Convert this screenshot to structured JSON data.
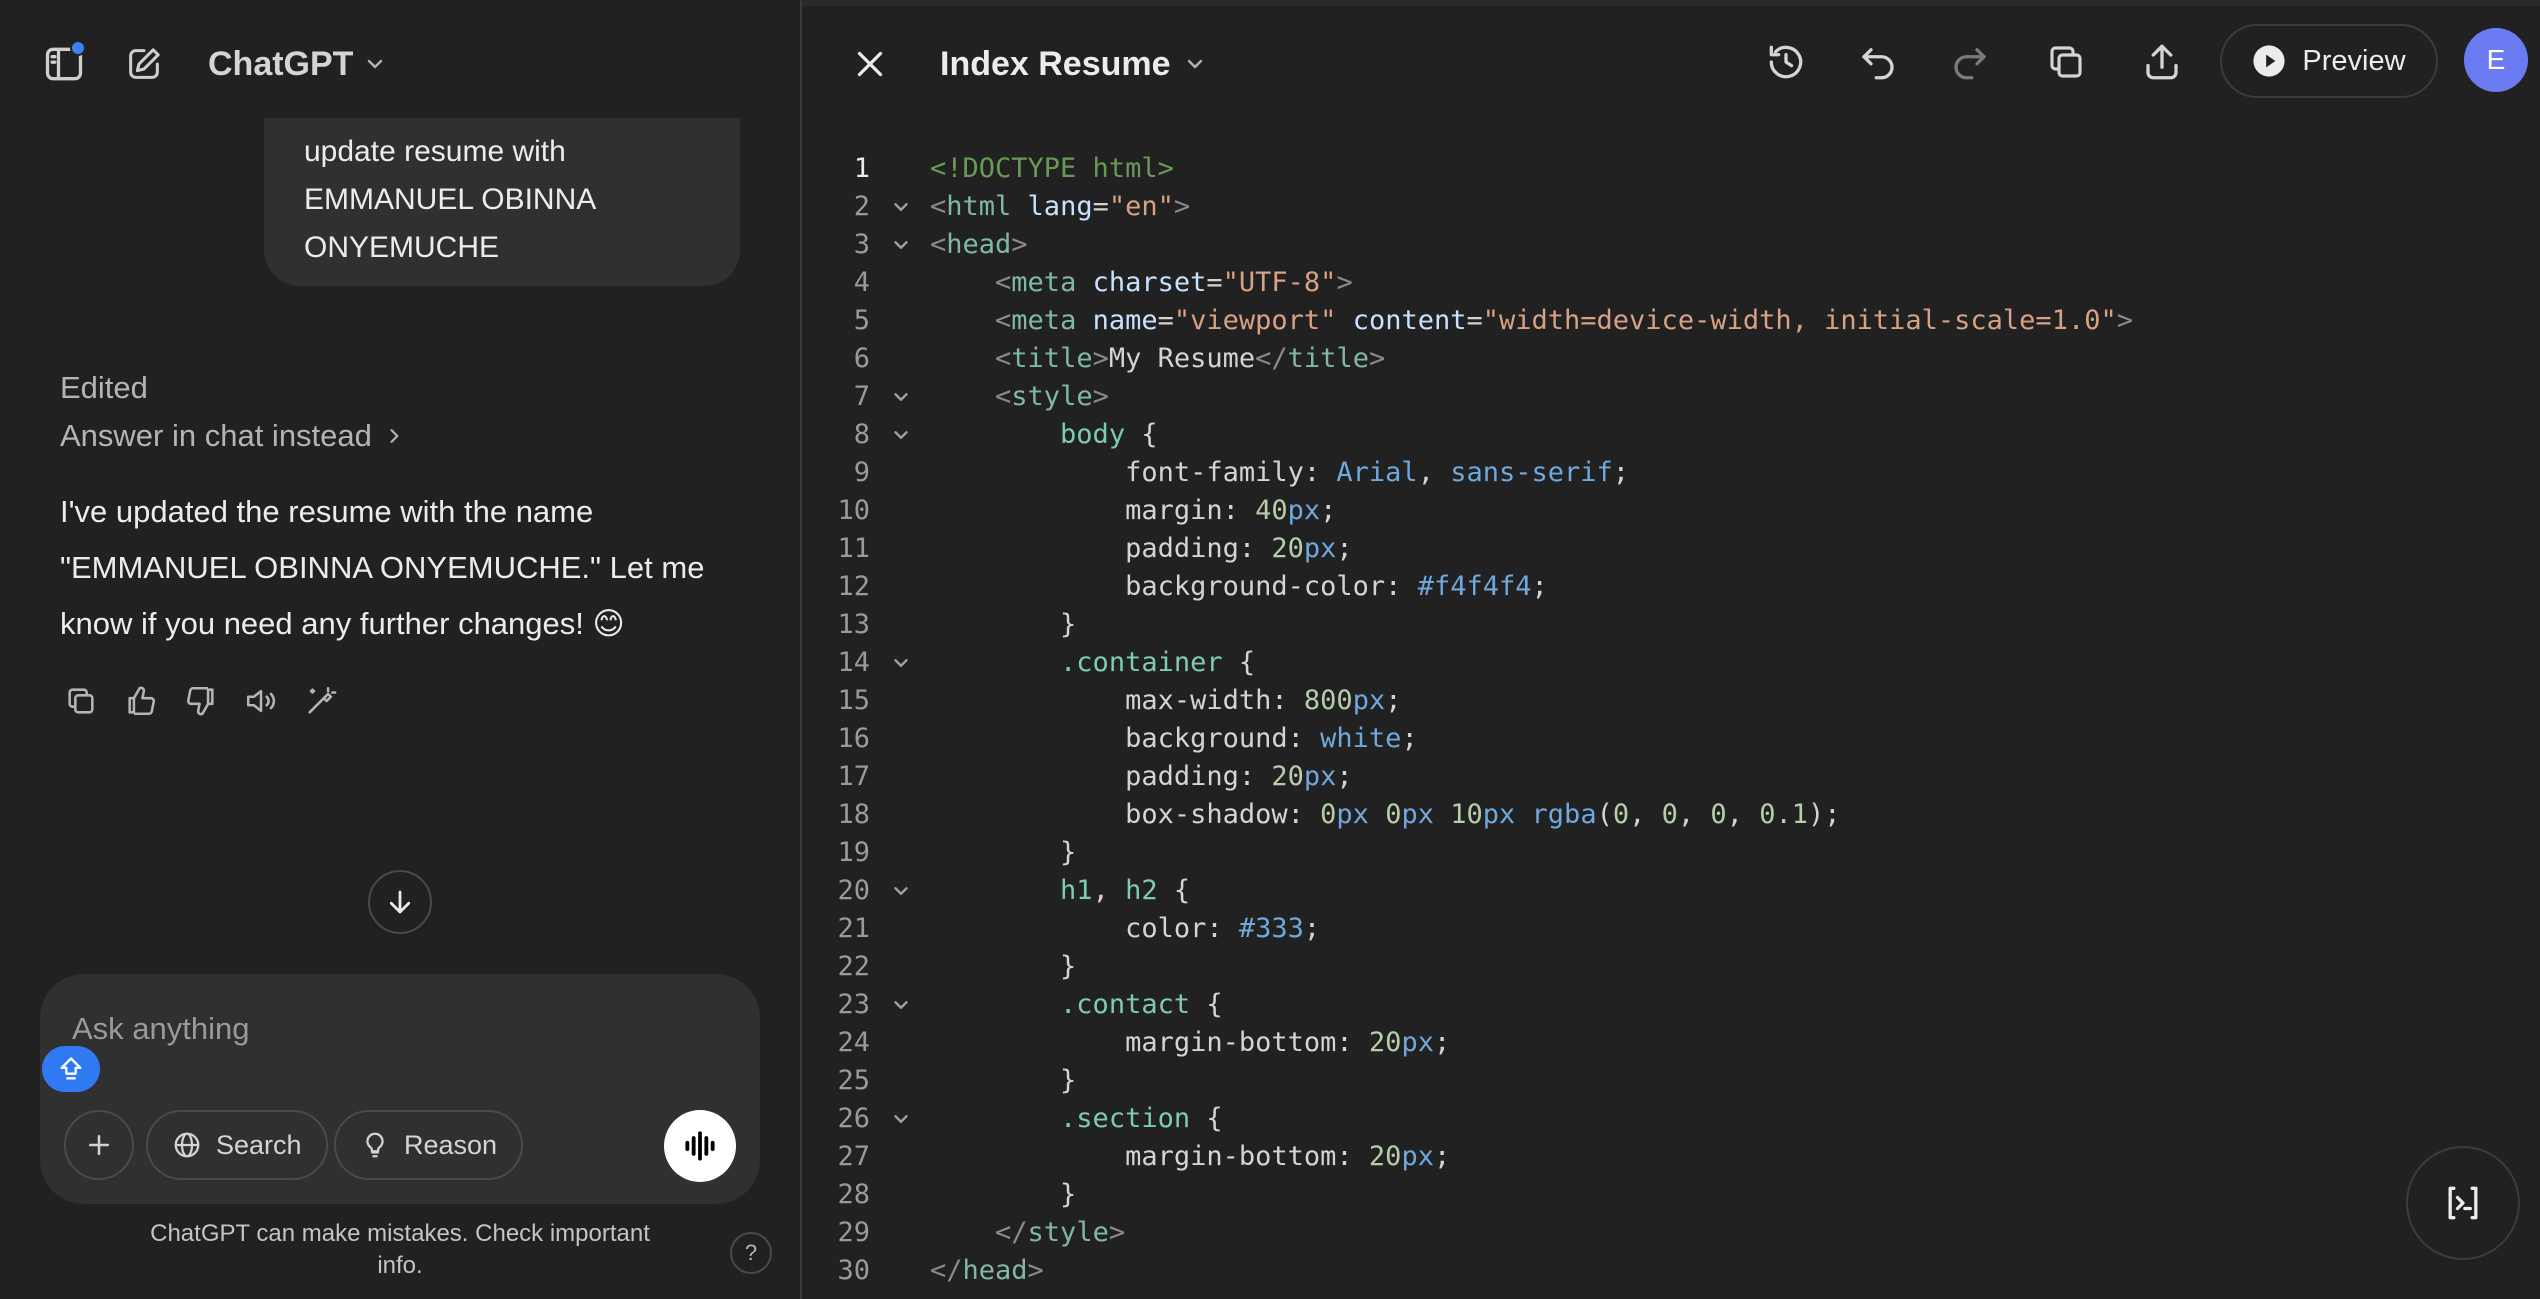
{
  "chat": {
    "model_name": "ChatGPT",
    "user_message_lines": [
      "update resume with",
      "EMMANUEL OBINNA",
      "ONYEMUCHE"
    ],
    "edited_label": "Edited",
    "answer_in_chat_label": "Answer in chat instead",
    "assistant_message_lines": [
      "I've updated the resume with the name",
      "\"EMMANUEL OBINNA ONYEMUCHE.\" Let me",
      "know if you need any further changes! 😊"
    ],
    "composer": {
      "placeholder": "Ask anything",
      "search_label": "Search",
      "reason_label": "Reason"
    },
    "disclaimer_lines": [
      "ChatGPT can make mistakes. Check important",
      "info."
    ],
    "help_label": "?"
  },
  "canvas": {
    "title": "Index Resume",
    "preview_label": "Preview",
    "avatar_initial": "E",
    "code_lines": [
      {
        "n": "1",
        "fold": false,
        "segs": [
          [
            "doc",
            "<!DOCTYPE html>"
          ]
        ]
      },
      {
        "n": "2",
        "fold": true,
        "segs": [
          [
            "br",
            "<"
          ],
          [
            "tag",
            "html"
          ],
          [
            "attr",
            " lang"
          ],
          [
            "pun",
            "="
          ],
          [
            "str",
            "\"en\""
          ],
          [
            "br",
            ">"
          ]
        ]
      },
      {
        "n": "3",
        "fold": true,
        "segs": [
          [
            "br",
            "<"
          ],
          [
            "tag",
            "head"
          ],
          [
            "br",
            ">"
          ]
        ]
      },
      {
        "n": "4",
        "fold": false,
        "segs": [
          [
            "txt",
            "    "
          ],
          [
            "br",
            "<"
          ],
          [
            "tag",
            "meta"
          ],
          [
            "attr",
            " charset"
          ],
          [
            "pun",
            "="
          ],
          [
            "str",
            "\"UTF-8\""
          ],
          [
            "br",
            ">"
          ]
        ]
      },
      {
        "n": "5",
        "fold": false,
        "segs": [
          [
            "txt",
            "    "
          ],
          [
            "br",
            "<"
          ],
          [
            "tag",
            "meta"
          ],
          [
            "attr",
            " name"
          ],
          [
            "pun",
            "="
          ],
          [
            "str",
            "\"viewport\""
          ],
          [
            "attr",
            " content"
          ],
          [
            "pun",
            "="
          ],
          [
            "str",
            "\"width=device-width, initial-scale=1.0\""
          ],
          [
            "br",
            ">"
          ]
        ]
      },
      {
        "n": "6",
        "fold": false,
        "segs": [
          [
            "txt",
            "    "
          ],
          [
            "br",
            "<"
          ],
          [
            "tag",
            "title"
          ],
          [
            "br",
            ">"
          ],
          [
            "txt",
            "My Resume"
          ],
          [
            "br",
            "</"
          ],
          [
            "tag",
            "title"
          ],
          [
            "br",
            ">"
          ]
        ]
      },
      {
        "n": "7",
        "fold": true,
        "segs": [
          [
            "txt",
            "    "
          ],
          [
            "br",
            "<"
          ],
          [
            "tag",
            "style"
          ],
          [
            "br",
            ">"
          ]
        ]
      },
      {
        "n": "8",
        "fold": true,
        "segs": [
          [
            "txt",
            "        "
          ],
          [
            "sel",
            "body"
          ],
          [
            "pun",
            " {"
          ]
        ]
      },
      {
        "n": "9",
        "fold": false,
        "segs": [
          [
            "txt",
            "            "
          ],
          [
            "prop",
            "font-family"
          ],
          [
            "pun",
            ": "
          ],
          [
            "kw",
            "Arial"
          ],
          [
            "pun",
            ", "
          ],
          [
            "kw",
            "sans-serif"
          ],
          [
            "pun",
            ";"
          ]
        ]
      },
      {
        "n": "10",
        "fold": false,
        "segs": [
          [
            "txt",
            "            "
          ],
          [
            "prop",
            "margin"
          ],
          [
            "pun",
            ": "
          ],
          [
            "num",
            "40"
          ],
          [
            "unit",
            "px"
          ],
          [
            "pun",
            ";"
          ]
        ]
      },
      {
        "n": "11",
        "fold": false,
        "segs": [
          [
            "txt",
            "            "
          ],
          [
            "prop",
            "padding"
          ],
          [
            "pun",
            ": "
          ],
          [
            "num",
            "20"
          ],
          [
            "unit",
            "px"
          ],
          [
            "pun",
            ";"
          ]
        ]
      },
      {
        "n": "12",
        "fold": false,
        "segs": [
          [
            "txt",
            "            "
          ],
          [
            "prop",
            "background-color"
          ],
          [
            "pun",
            ": "
          ],
          [
            "kw",
            "#f4f4f4"
          ],
          [
            "pun",
            ";"
          ]
        ]
      },
      {
        "n": "13",
        "fold": false,
        "segs": [
          [
            "txt",
            "        "
          ],
          [
            "pun",
            "}"
          ]
        ]
      },
      {
        "n": "14",
        "fold": true,
        "segs": [
          [
            "txt",
            "        "
          ],
          [
            "sel",
            ".container"
          ],
          [
            "pun",
            " {"
          ]
        ]
      },
      {
        "n": "15",
        "fold": false,
        "segs": [
          [
            "txt",
            "            "
          ],
          [
            "prop",
            "max-width"
          ],
          [
            "pun",
            ": "
          ],
          [
            "num",
            "800"
          ],
          [
            "unit",
            "px"
          ],
          [
            "pun",
            ";"
          ]
        ]
      },
      {
        "n": "16",
        "fold": false,
        "segs": [
          [
            "txt",
            "            "
          ],
          [
            "prop",
            "background"
          ],
          [
            "pun",
            ": "
          ],
          [
            "kw",
            "white"
          ],
          [
            "pun",
            ";"
          ]
        ]
      },
      {
        "n": "17",
        "fold": false,
        "segs": [
          [
            "txt",
            "            "
          ],
          [
            "prop",
            "padding"
          ],
          [
            "pun",
            ": "
          ],
          [
            "num",
            "20"
          ],
          [
            "unit",
            "px"
          ],
          [
            "pun",
            ";"
          ]
        ]
      },
      {
        "n": "18",
        "fold": false,
        "segs": [
          [
            "txt",
            "            "
          ],
          [
            "prop",
            "box-shadow"
          ],
          [
            "pun",
            ": "
          ],
          [
            "num",
            "0"
          ],
          [
            "unit",
            "px"
          ],
          [
            "pun",
            " "
          ],
          [
            "num",
            "0"
          ],
          [
            "unit",
            "px"
          ],
          [
            "pun",
            " "
          ],
          [
            "num",
            "10"
          ],
          [
            "unit",
            "px"
          ],
          [
            "pun",
            " "
          ],
          [
            "kw",
            "rgba"
          ],
          [
            "pun",
            "("
          ],
          [
            "num",
            "0"
          ],
          [
            "pun",
            ", "
          ],
          [
            "num",
            "0"
          ],
          [
            "pun",
            ", "
          ],
          [
            "num",
            "0"
          ],
          [
            "pun",
            ", "
          ],
          [
            "num",
            "0.1"
          ],
          [
            "pun",
            ");"
          ]
        ]
      },
      {
        "n": "19",
        "fold": false,
        "segs": [
          [
            "txt",
            "        "
          ],
          [
            "pun",
            "}"
          ]
        ]
      },
      {
        "n": "20",
        "fold": true,
        "segs": [
          [
            "txt",
            "        "
          ],
          [
            "sel",
            "h1"
          ],
          [
            "pun",
            ", "
          ],
          [
            "sel",
            "h2"
          ],
          [
            "pun",
            " {"
          ]
        ]
      },
      {
        "n": "21",
        "fold": false,
        "segs": [
          [
            "txt",
            "            "
          ],
          [
            "prop",
            "color"
          ],
          [
            "pun",
            ": "
          ],
          [
            "kw",
            "#333"
          ],
          [
            "pun",
            ";"
          ]
        ]
      },
      {
        "n": "22",
        "fold": false,
        "segs": [
          [
            "txt",
            "        "
          ],
          [
            "pun",
            "}"
          ]
        ]
      },
      {
        "n": "23",
        "fold": true,
        "segs": [
          [
            "txt",
            "        "
          ],
          [
            "sel",
            ".contact"
          ],
          [
            "pun",
            " {"
          ]
        ]
      },
      {
        "n": "24",
        "fold": false,
        "segs": [
          [
            "txt",
            "            "
          ],
          [
            "prop",
            "margin-bottom"
          ],
          [
            "pun",
            ": "
          ],
          [
            "num",
            "20"
          ],
          [
            "unit",
            "px"
          ],
          [
            "pun",
            ";"
          ]
        ]
      },
      {
        "n": "25",
        "fold": false,
        "segs": [
          [
            "txt",
            "        "
          ],
          [
            "pun",
            "}"
          ]
        ]
      },
      {
        "n": "26",
        "fold": true,
        "segs": [
          [
            "txt",
            "        "
          ],
          [
            "sel",
            ".section"
          ],
          [
            "pun",
            " {"
          ]
        ]
      },
      {
        "n": "27",
        "fold": false,
        "segs": [
          [
            "txt",
            "            "
          ],
          [
            "prop",
            "margin-bottom"
          ],
          [
            "pun",
            ": "
          ],
          [
            "num",
            "20"
          ],
          [
            "unit",
            "px"
          ],
          [
            "pun",
            ";"
          ]
        ]
      },
      {
        "n": "28",
        "fold": false,
        "segs": [
          [
            "txt",
            "        "
          ],
          [
            "pun",
            "}"
          ]
        ]
      },
      {
        "n": "29",
        "fold": false,
        "segs": [
          [
            "txt",
            "    "
          ],
          [
            "br",
            "</"
          ],
          [
            "tag",
            "style"
          ],
          [
            "br",
            ">"
          ]
        ]
      },
      {
        "n": "30",
        "fold": false,
        "segs": [
          [
            "br",
            "</"
          ],
          [
            "tag",
            "head"
          ],
          [
            "br",
            ">"
          ]
        ]
      }
    ]
  },
  "colors": {
    "background": "#212121",
    "surface": "#303030",
    "accent_blue": "#3b82f6",
    "avatar": "#6b7cf3"
  },
  "icons": {
    "sidebar_toggle": "sidebar-icon",
    "new_chat": "edit-icon",
    "close": "close-icon",
    "history": "history-icon",
    "undo": "undo-icon",
    "redo": "redo-icon",
    "copy": "copy-icon",
    "share": "share-icon",
    "preview": "play-icon",
    "run": "console-icon"
  }
}
